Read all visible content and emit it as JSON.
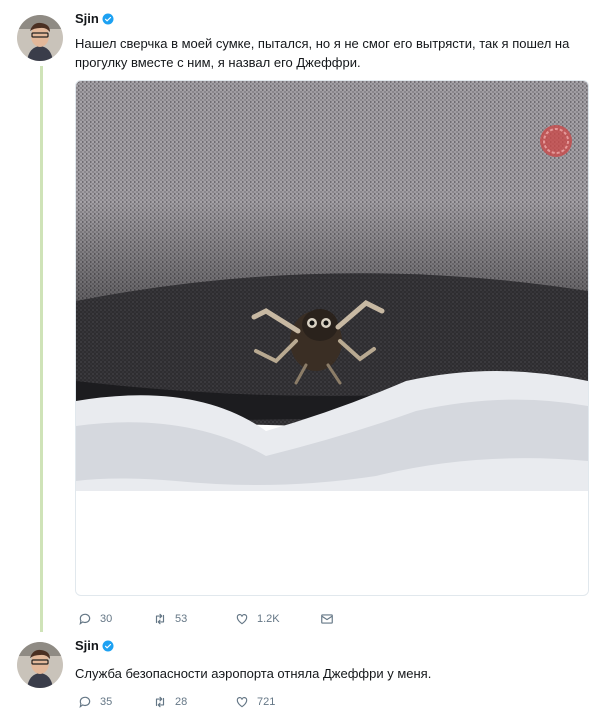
{
  "tweets": [
    {
      "author": "Sjin",
      "text": "Нашел сверчка в моей сумке, пытался, но я не смог его вытрясти, так я пошел на прогулку вместе с ним, я назвал его Джеффри.",
      "replies": "30",
      "retweets": "53",
      "likes": "1.2K"
    },
    {
      "author": "Sjin",
      "text": "Служба безопасности аэропорта отняла Джеффри у меня.",
      "replies": "35",
      "retweets": "28",
      "likes": "721"
    }
  ],
  "colors": {
    "verified": "#1da1f2",
    "icon": "#657786",
    "thread_line": "#cfe3b8"
  },
  "icons": [
    "reply-icon",
    "retweet-icon",
    "like-icon",
    "message-icon",
    "verified-badge-icon"
  ]
}
